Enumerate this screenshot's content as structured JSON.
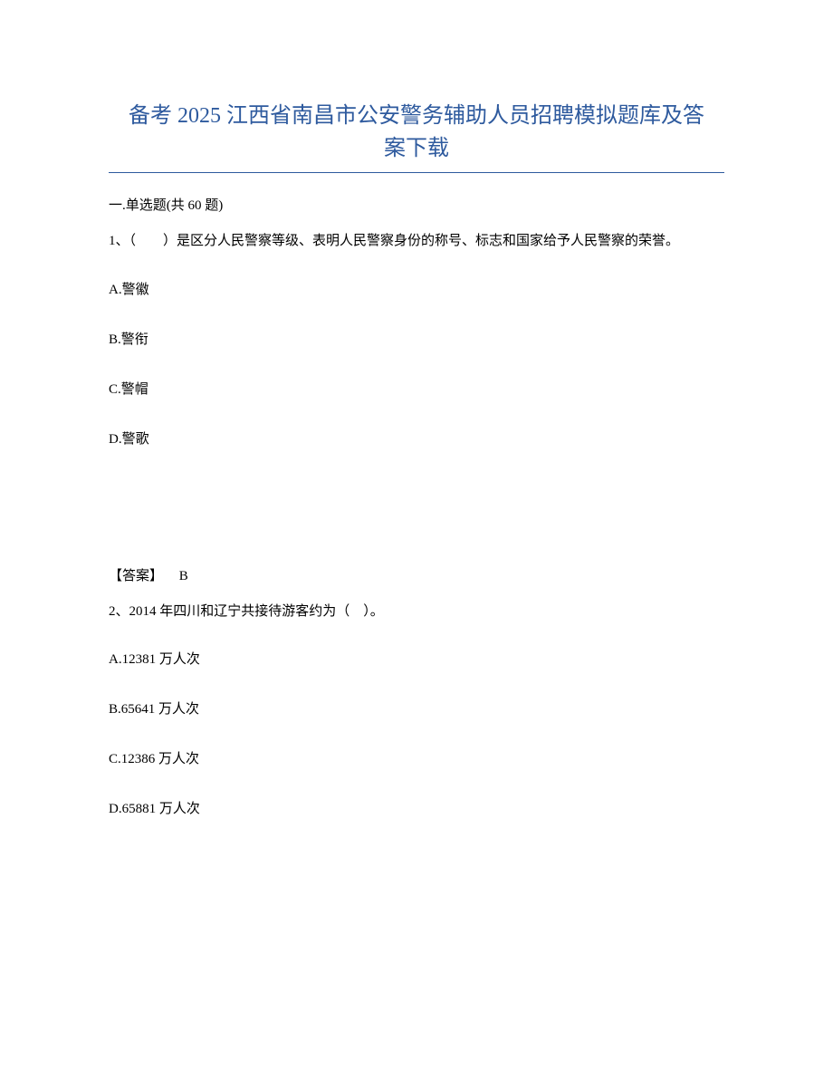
{
  "title": "备考 2025 江西省南昌市公安警务辅助人员招聘模拟题库及答案下载",
  "section_header": "一.单选题(共 60 题)",
  "q1": {
    "text": "1、（　　）是区分人民警察等级、表明人民警察身份的称号、标志和国家给予人民警察的荣誉。",
    "options": {
      "a": "A.警徽",
      "b": "B.警衔",
      "c": "C.警帽",
      "d": "D.警歌"
    },
    "answer_label": "【答案】",
    "answer_value": "B"
  },
  "q2": {
    "text": "2、2014 年四川和辽宁共接待游客约为（　）。",
    "options": {
      "a": "A.12381 万人次",
      "b": "B.65641 万人次",
      "c": "C.12386 万人次",
      "d": "D.65881 万人次"
    }
  }
}
